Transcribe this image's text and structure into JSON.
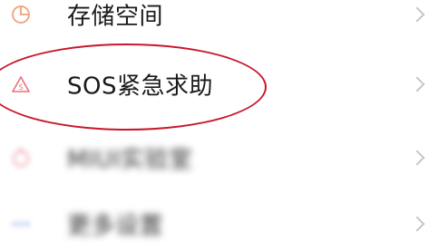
{
  "menu": {
    "items": [
      {
        "label": "存储空间",
        "icon": "pie-chart-icon",
        "icon_color": "#f0a27a"
      },
      {
        "label": "SOS紧急求助",
        "icon": "sos-alert-icon",
        "icon_color": "#e8707a"
      },
      {
        "label": "MIUI实验室",
        "icon": "stopwatch-icon",
        "icon_color": "#f0a0a8",
        "blurred": true
      },
      {
        "label": "更多设置",
        "icon": "more-dots-icon",
        "icon_color": "#7fa7e6",
        "blurred": true
      }
    ]
  },
  "annotation": {
    "highlight_color": "#c8162b"
  }
}
